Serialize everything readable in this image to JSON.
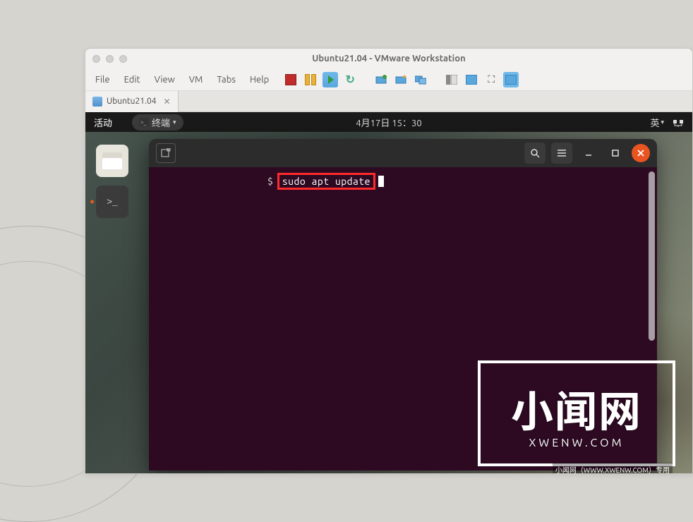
{
  "host_window": {
    "title": "Ubuntu21.04 - VMware Workstation",
    "menus": [
      "File",
      "Edit",
      "View",
      "VM",
      "Tabs",
      "Help"
    ],
    "tab_label": "Ubuntu21.04"
  },
  "guest_topbar": {
    "activities": "活动",
    "app_name": "终端",
    "clock": "4月17日 15：30",
    "ime": "英"
  },
  "terminal": {
    "prompt": "$",
    "command": "sudo apt update"
  },
  "watermark": {
    "big": "小闻网",
    "small": "XWENW.COM",
    "tiny": "小闻网（WWW.XWENW.COM）专用"
  }
}
